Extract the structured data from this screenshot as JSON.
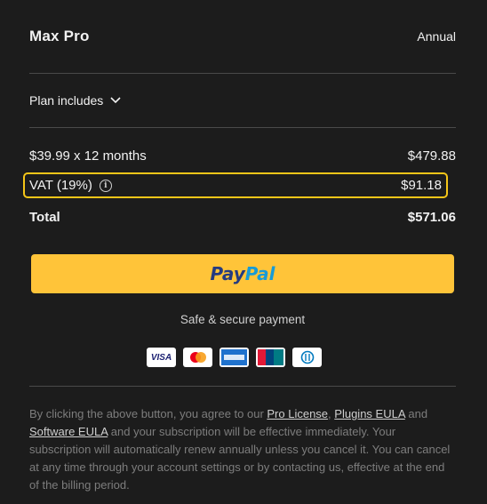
{
  "plan": {
    "name": "Max Pro",
    "period": "Annual"
  },
  "includes": {
    "label": "Plan includes"
  },
  "lines": {
    "base": {
      "label": "$39.99 x 12 months",
      "price": "$479.88"
    },
    "vat": {
      "label": "VAT (19%)",
      "price": "$91.18",
      "info_icon": "info-icon"
    },
    "total": {
      "label": "Total",
      "price": "$571.06"
    }
  },
  "payment": {
    "button_part1": "Pay",
    "button_part2": "Pal",
    "secure_text": "Safe & secure payment",
    "cards": [
      "visa",
      "mastercard",
      "amex",
      "unionpay",
      "diners"
    ]
  },
  "legal": {
    "pre": "By clicking the above button, you agree to our ",
    "link1": "Pro License",
    "sep1": ", ",
    "link2": "Plugins EULA",
    "mid": " and ",
    "link3": "Software EULA",
    "post": " and your subscription will be effective immediately. Your subscription will automatically renew annually unless you cancel it. You can cancel at any time through your account settings or by contacting us, effective at the end of the billing period."
  },
  "colors": {
    "background": "#1c1c1c",
    "paypal": "#ffc439",
    "highlight": "#f5c518"
  }
}
